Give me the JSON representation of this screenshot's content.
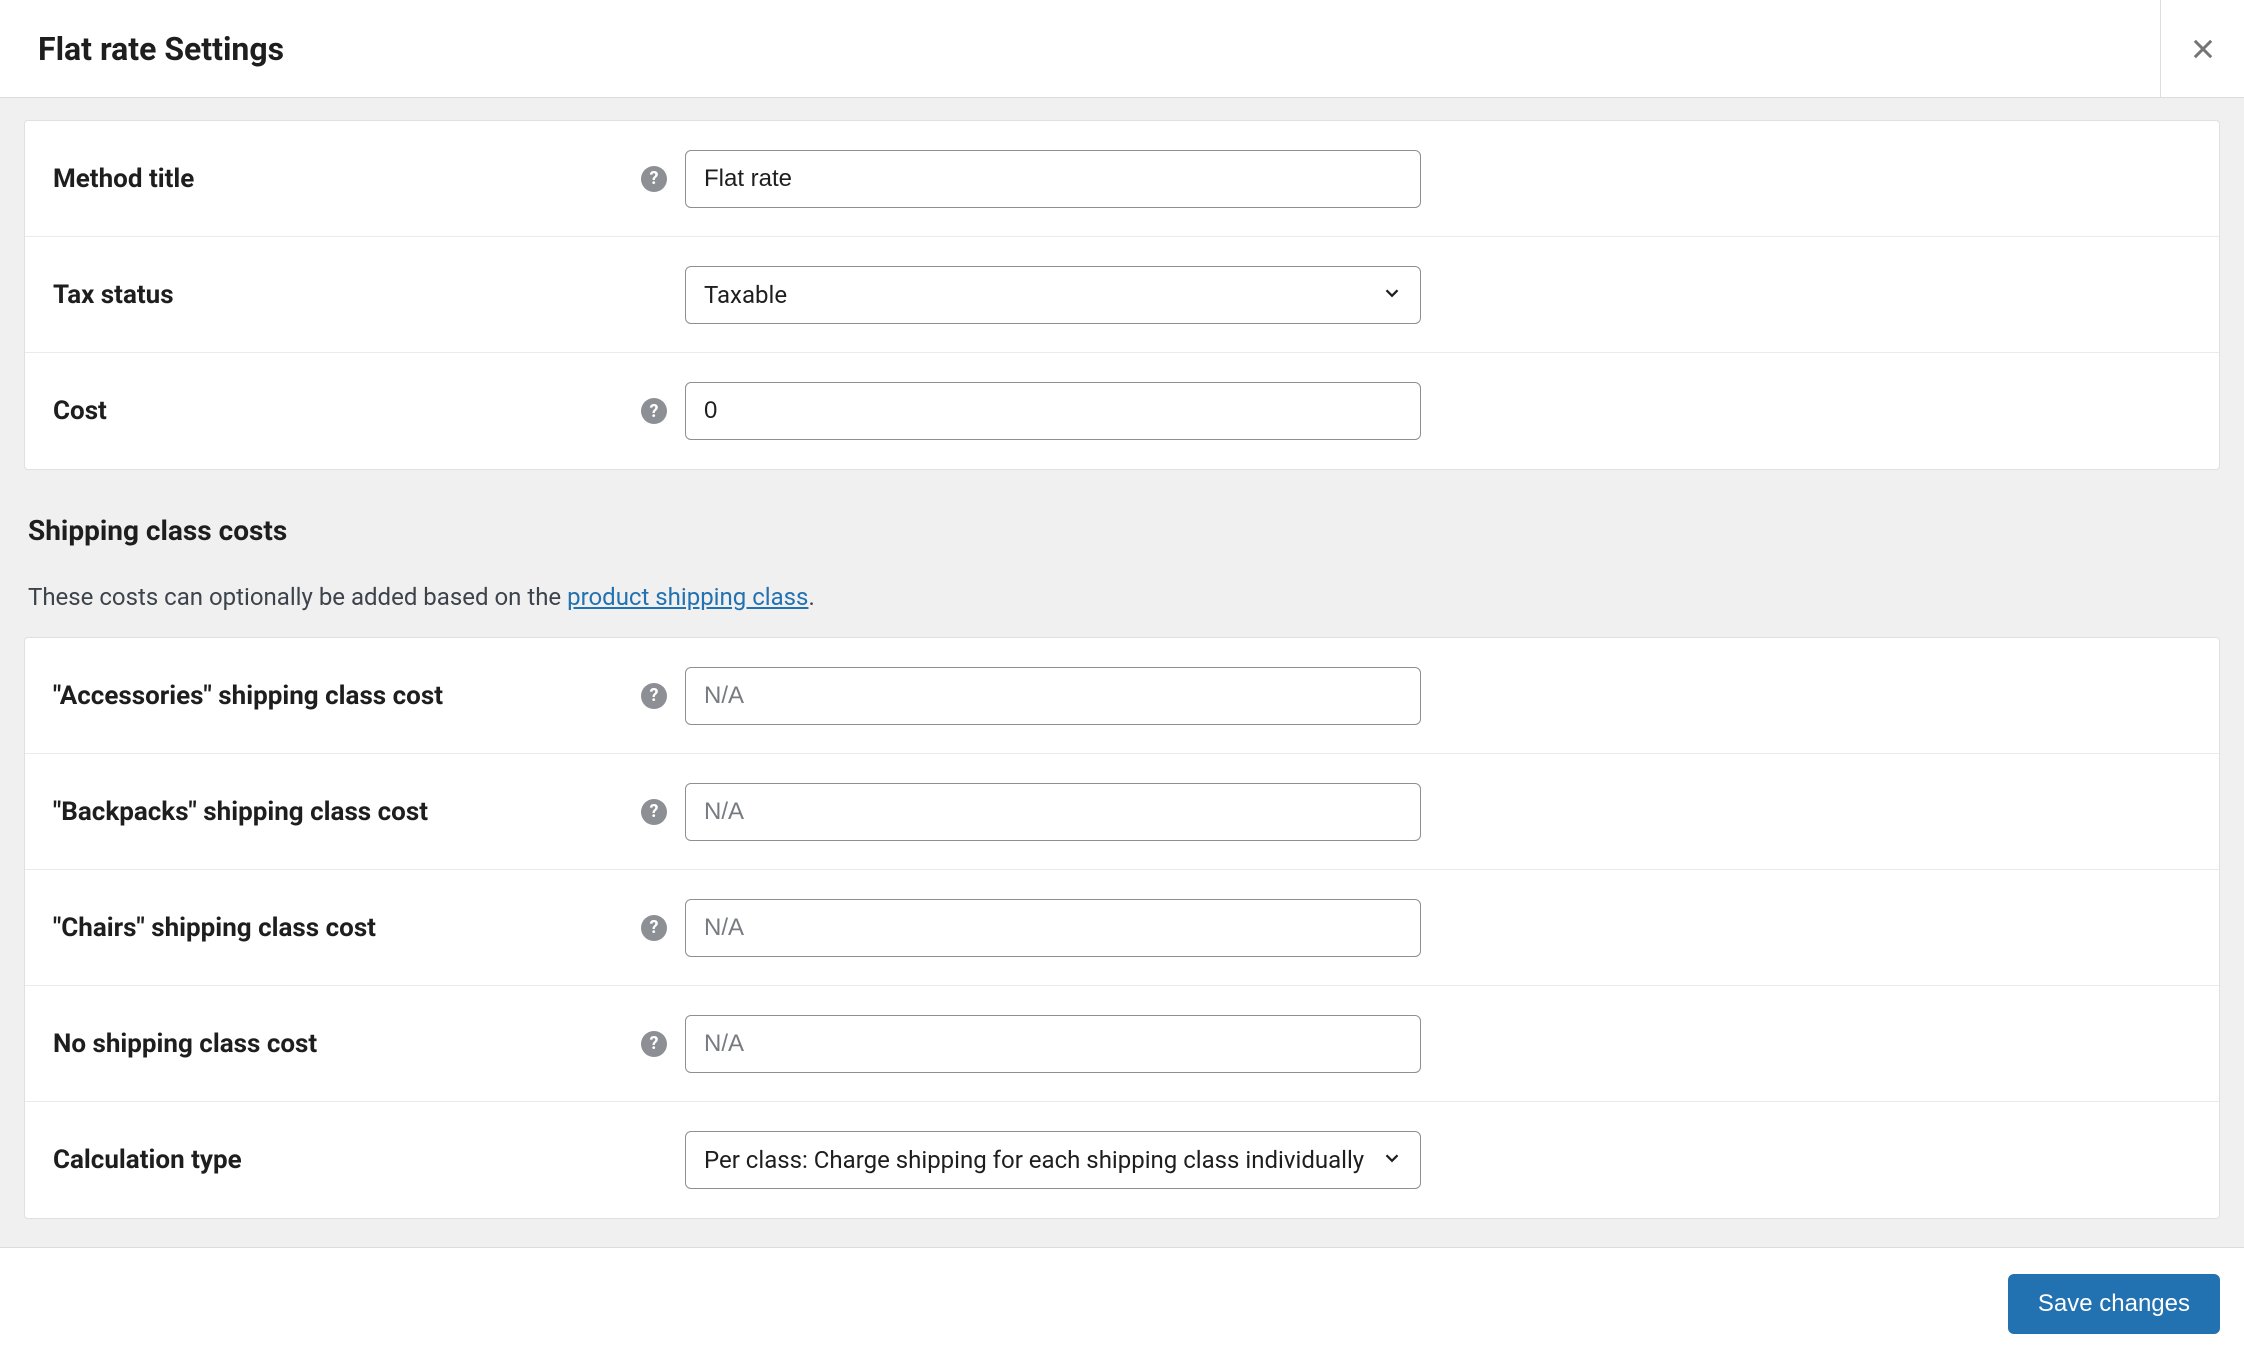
{
  "header": {
    "title": "Flat rate Settings"
  },
  "fields": {
    "method_title": {
      "label": "Method title",
      "value": "Flat rate"
    },
    "tax_status": {
      "label": "Tax status",
      "value": "Taxable"
    },
    "cost": {
      "label": "Cost",
      "value": "0"
    }
  },
  "section": {
    "title": "Shipping class costs",
    "desc_prefix": "These costs can optionally be added based on the ",
    "desc_link": "product shipping class",
    "desc_suffix": "."
  },
  "class_costs": {
    "placeholder": "N/A",
    "accessories": {
      "label": "\"Accessories\" shipping class cost",
      "value": ""
    },
    "backpacks": {
      "label": "\"Backpacks\" shipping class cost",
      "value": ""
    },
    "chairs": {
      "label": "\"Chairs\" shipping class cost",
      "value": ""
    },
    "none": {
      "label": "No shipping class cost",
      "value": ""
    },
    "calc_type": {
      "label": "Calculation type",
      "value": "Per class: Charge shipping for each shipping class individually"
    }
  },
  "footer": {
    "save": "Save changes"
  }
}
